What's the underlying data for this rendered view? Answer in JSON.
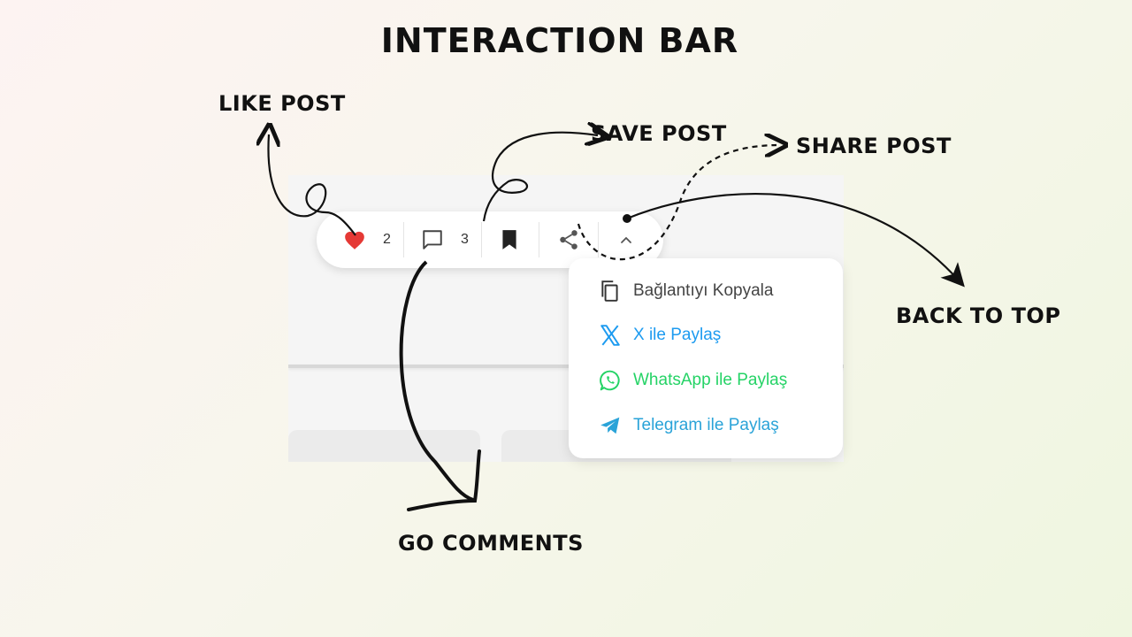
{
  "title": "INTERACTION BAR",
  "labels": {
    "like": "LIKE POST",
    "save": "SAVE POST",
    "share": "SHARE POST",
    "back_to_top": "BACK TO TOP",
    "comments": "GO COMMENTS"
  },
  "bar": {
    "like_count": "2",
    "comment_count": "3",
    "icons": [
      "heart-icon",
      "comment-icon",
      "bookmark-icon",
      "share-icon",
      "chevron-up-icon"
    ]
  },
  "share_menu": {
    "items": [
      {
        "label": "Bağlantıyı Kopyala",
        "icon": "copy-icon",
        "color": "#444444"
      },
      {
        "label": "X ile Paylaş",
        "icon": "x-icon",
        "color": "#1d9bf0"
      },
      {
        "label": "WhatsApp ile Paylaş",
        "icon": "whatsapp-icon",
        "color": "#25d366"
      },
      {
        "label": "Telegram ile Paylaş",
        "icon": "telegram-icon",
        "color": "#2aa3d8"
      }
    ]
  },
  "colors": {
    "heart": "#e53935",
    "ink": "#111111"
  }
}
